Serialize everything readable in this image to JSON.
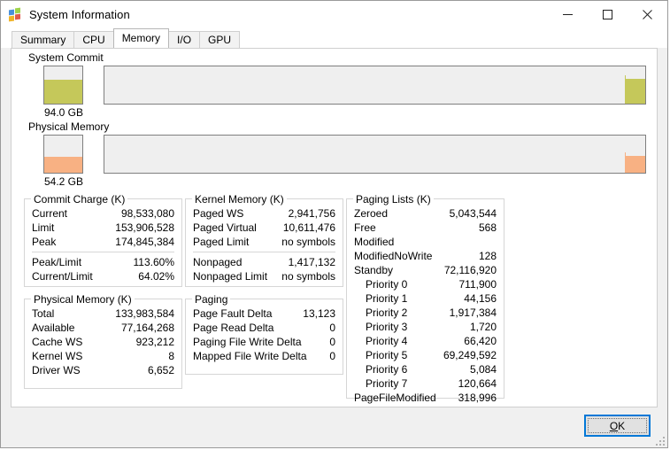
{
  "window": {
    "title": "System Information",
    "icon": "process-explorer-icon",
    "controls": {
      "minimize": "minimize-icon",
      "maximize": "maximize-icon",
      "close": "close-icon"
    }
  },
  "tabs": [
    {
      "label": "Summary",
      "active": false
    },
    {
      "label": "CPU",
      "active": false
    },
    {
      "label": "Memory",
      "active": true
    },
    {
      "label": "I/O",
      "active": false
    },
    {
      "label": "GPU",
      "active": false
    }
  ],
  "meters": {
    "system_commit": {
      "label": "System Commit",
      "value": "94.0 GB",
      "fill_percent": 64.02,
      "color": "#c5c85a"
    },
    "physical_memory": {
      "label": "Physical Memory",
      "value": "54.2 GB",
      "fill_percent": 42.4,
      "color": "#f8b183"
    }
  },
  "groups": {
    "commit_charge": {
      "legend": "Commit Charge (K)",
      "rows": [
        {
          "key": "Current",
          "value": "98,533,080"
        },
        {
          "key": "Limit",
          "value": "153,906,528"
        },
        {
          "key": "Peak",
          "value": "174,845,384"
        },
        {
          "separator": true
        },
        {
          "key": "Peak/Limit",
          "value": "113.60%"
        },
        {
          "key": "Current/Limit",
          "value": "64.02%"
        }
      ]
    },
    "physical_memory": {
      "legend": "Physical Memory (K)",
      "rows": [
        {
          "key": "Total",
          "value": "133,983,584"
        },
        {
          "key": "Available",
          "value": "77,164,268"
        },
        {
          "key": "Cache WS",
          "value": "923,212"
        },
        {
          "key": "Kernel WS",
          "value": "8"
        },
        {
          "key": "Driver WS",
          "value": "6,652"
        }
      ]
    },
    "kernel_memory": {
      "legend": "Kernel Memory (K)",
      "rows": [
        {
          "key": "Paged WS",
          "value": "2,941,756"
        },
        {
          "key": "Paged Virtual",
          "value": "10,611,476"
        },
        {
          "key": "Paged Limit",
          "value": "no symbols"
        },
        {
          "separator": true
        },
        {
          "key": "Nonpaged",
          "value": "1,417,132"
        },
        {
          "key": "Nonpaged Limit",
          "value": "no symbols"
        }
      ]
    },
    "paging": {
      "legend": "Paging",
      "rows": [
        {
          "key": "Page Fault Delta",
          "value": "13,123"
        },
        {
          "key": "Page Read Delta",
          "value": "0"
        },
        {
          "key": "Paging File Write Delta",
          "value": "0"
        },
        {
          "key": "Mapped File Write Delta",
          "value": "0"
        }
      ]
    },
    "paging_lists": {
      "legend": "Paging Lists (K)",
      "rows": [
        {
          "key": "Zeroed",
          "value": "5,043,544"
        },
        {
          "key": "Free",
          "value": "568"
        },
        {
          "key": "Modified",
          "value": ""
        },
        {
          "key": "ModifiedNoWrite",
          "value": "128"
        },
        {
          "key": "Standby",
          "value": "72,116,920"
        },
        {
          "key": "Priority 0",
          "value": "711,900",
          "indent": true
        },
        {
          "key": "Priority 1",
          "value": "44,156",
          "indent": true
        },
        {
          "key": "Priority 2",
          "value": "1,917,384",
          "indent": true
        },
        {
          "key": "Priority 3",
          "value": "1,720",
          "indent": true
        },
        {
          "key": "Priority 4",
          "value": "66,420",
          "indent": true
        },
        {
          "key": "Priority 5",
          "value": "69,249,592",
          "indent": true
        },
        {
          "key": "Priority 6",
          "value": "5,084",
          "indent": true
        },
        {
          "key": "Priority 7",
          "value": "120,664",
          "indent": true
        },
        {
          "key": "PageFileModified",
          "value": "318,996"
        }
      ]
    }
  },
  "footer": {
    "ok_label": "OK",
    "ok_accel": "O",
    "ok_rest": "K"
  }
}
